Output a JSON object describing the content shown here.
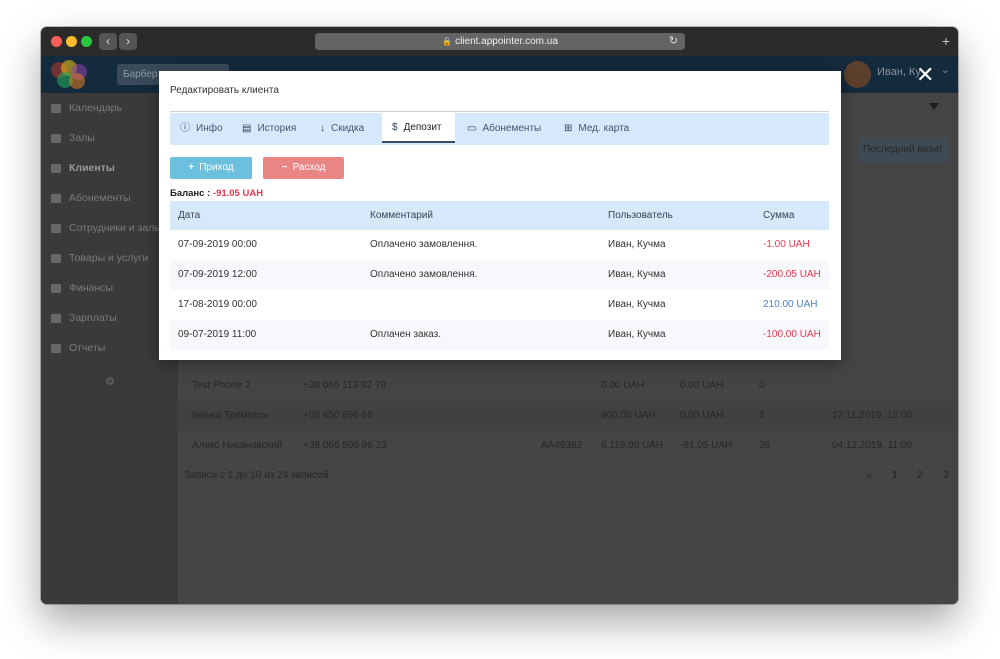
{
  "browser": {
    "url": "client.appointer.com.ua",
    "colors": {
      "close": "#fd5f57",
      "minimize": "#febc2e",
      "zoom": "#28c840"
    }
  },
  "app": {
    "search_text": "Барбер",
    "user_name": "Иван, Ку"
  },
  "sidebar": {
    "items": [
      {
        "label": "Календарь",
        "icon": "calendar-icon"
      },
      {
        "label": "Залы",
        "icon": "bookmark-icon"
      },
      {
        "label": "Клиенты",
        "icon": "users-icon"
      },
      {
        "label": "Абонементы",
        "icon": "card-icon"
      },
      {
        "label": "Сотрудники и залы",
        "icon": "staff-icon"
      },
      {
        "label": "Товары и услуги",
        "icon": "goods-icon"
      },
      {
        "label": "Финансы",
        "icon": "finance-icon"
      },
      {
        "label": "Зарплаты",
        "icon": "salary-icon"
      },
      {
        "label": "Отчеты",
        "icon": "reports-icon"
      }
    ],
    "active_index": 2
  },
  "background_table": {
    "last_visit_header": "Последний визит",
    "rows": [
      {
        "name": "Test Phone 2",
        "phone": "+38 066 113 92 79",
        "card": "",
        "total": "0.00 UAH",
        "deposit": "0.00 UAH",
        "visits": "0",
        "last_visit": ""
      },
      {
        "name": "Іванка Тремпель",
        "phone": "+06 650 696 66",
        "card": "",
        "total": "900.00 UAH",
        "deposit": "0.00 UAH",
        "visits": "2",
        "last_visit": "17.11.2019, 13:00"
      },
      {
        "name": "Алекс Никановский",
        "phone": "+38 066 506 96 23",
        "card": "AA49382",
        "total": "6 119.00 UAH",
        "deposit": "-91.05 UAH",
        "visits": "26",
        "last_visit": "04.12.2019, 11:00"
      }
    ],
    "footer": "Записи с 1 до 10 из 24 записей",
    "pager": [
      "«",
      "1",
      "2",
      "3",
      "»"
    ],
    "current_page": "1"
  },
  "modal": {
    "title": "Редактировать клиента",
    "tabs": [
      {
        "label": "Инфо",
        "icon": "info-icon"
      },
      {
        "label": "История",
        "icon": "id-card-icon"
      },
      {
        "label": "Скидка",
        "icon": "arrow-down-icon"
      },
      {
        "label": "Депозит",
        "icon": "dollar-icon"
      },
      {
        "label": "Абонементы",
        "icon": "credit-card-icon"
      },
      {
        "label": "Мед. карта",
        "icon": "plus-square-icon"
      }
    ],
    "active_tab": "Депозит",
    "income_button": "Приход",
    "expense_button": "Расход",
    "balance_label": "Баланс :",
    "balance_value": "-91.05 UAH",
    "table": {
      "headers": [
        "Дата",
        "Комментарий",
        "Пользователь",
        "Сумма"
      ],
      "rows": [
        {
          "date": "07-09-2019 00:00",
          "comment": "Оплачено замовлення.",
          "user": "Иван, Кучма",
          "amount": "-1.00 UAH",
          "sign": "negative"
        },
        {
          "date": "07-09-2019 12:00",
          "comment": "Оплачено замовлення.",
          "user": "Иван, Кучма",
          "amount": "-200.05 UAH",
          "sign": "negative"
        },
        {
          "date": "17-08-2019 00:00",
          "comment": "",
          "user": "Иван, Кучма",
          "amount": "210.00 UAH",
          "sign": "positive"
        },
        {
          "date": "09-07-2019 11:00",
          "comment": "Оплачен заказ.",
          "user": "Иван, Кучма",
          "amount": "-100.00 UAH",
          "sign": "negative"
        }
      ]
    },
    "colors": {
      "negative": "#e8374f",
      "positive": "#4e7fbf",
      "income_button": "#6cc0dd",
      "expense_button": "#e98585",
      "tab_bar": "#d6e9fa"
    }
  }
}
